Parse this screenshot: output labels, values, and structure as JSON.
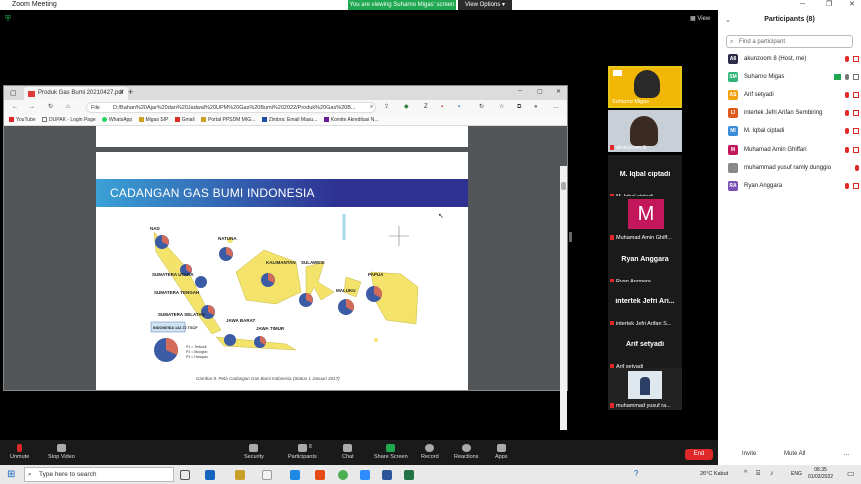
{
  "zoom": {
    "title": "Zoom Meeting",
    "share_banner": "You are viewing Suharno Migas' screen",
    "view_options": "View Options",
    "view_label": "View"
  },
  "browser": {
    "tab_title": "Produk Gas Bumi 20210427.pdf",
    "file_label": "File",
    "url": "D:/Bahan%20Ajar%20dan%20Jadwal%20UPM%20Gas%20Bumi%202022/Produk%20Gas%20B...",
    "bookmarks": [
      "YouTube",
      "DUPAK - Login Page",
      "WhatsApp",
      "Migas SIP",
      "Gmail",
      "Portal PPSDM MIG...",
      "Zimbra: Email Masu...",
      "Komite Akreditasi N..."
    ]
  },
  "slide": {
    "title": "CADANGAN GAS BUMI INDONESIA",
    "caption": "Gambar 8. Peta Cadangan Gas Bumi Indonesia (Status 1 Januari 2017)",
    "regions": [
      "NAD",
      "NATUNA",
      "SUMATERA UTARA",
      "KALIMANTAN",
      "SULAWESI",
      "PAPUA",
      "SUMATERA TENGAH",
      "MALUKU",
      "SUMATERA SELATAN",
      "JAWA BARAT",
      "JAWA TIMUR",
      "INDONESIA 142.72 TSCF"
    ],
    "legend": [
      "P1 = Terbukti",
      "P2 = Mungkin",
      "P3 = Harapan"
    ]
  },
  "tiles": [
    {
      "name": "Suharno Migas",
      "big": ""
    },
    {
      "name": "akunzoom 8",
      "big": ""
    },
    {
      "name": "M. Iqbal ciptadi",
      "big": "M. Iqbal ciptadi"
    },
    {
      "name": "Muhamad Amin Ghiff...",
      "big": "M"
    },
    {
      "name": "Ryan Anggara",
      "big": "Ryan Anggara"
    },
    {
      "name": "intertek Jefri Arifan S...",
      "big": "intertek Jefri Ari..."
    },
    {
      "name": "Arif setyadi",
      "big": "Arif setyadi"
    },
    {
      "name": "muhammad yusuf ra...",
      "big": ""
    }
  ],
  "panel": {
    "title": "Participants (8)",
    "search_placeholder": "Find a participant",
    "participants": [
      {
        "initials": "A8",
        "name": "akunzoom 8 (Host, me)",
        "color": "#2d2d4a"
      },
      {
        "initials": "SM",
        "name": "Suharno Migas",
        "color": "#2fb57a"
      },
      {
        "initials": "AS",
        "name": "Arif setyadi",
        "color": "#f2a20c"
      },
      {
        "initials": "IJ",
        "name": "intertek Jefri Arifan Sembiring",
        "color": "#e05a1b"
      },
      {
        "initials": "MI",
        "name": "M. Iqbal ciptadi",
        "color": "#3a8bd8"
      },
      {
        "initials": "M",
        "name": "Muhamad Amin Ghiffari",
        "color": "#c2185b"
      },
      {
        "initials": "",
        "name": "muhammad yusuf ramly dunggio",
        "color": "#888888"
      },
      {
        "initials": "RA",
        "name": "Ryan Anggara",
        "color": "#7b4fb5"
      }
    ],
    "invite": "Invite",
    "mute_all": "Mute All"
  },
  "toolbar": {
    "unmute": "Unmute",
    "stop_video": "Stop Video",
    "security": "Security",
    "participants": "Participants",
    "participants_count": "8",
    "chat": "Chat",
    "share_screen": "Share Screen",
    "record": "Record",
    "reactions": "Reactions",
    "apps": "Apps",
    "end": "End"
  },
  "taskbar": {
    "search_placeholder": "Type here to search",
    "weather": "26°C  Kabut",
    "lang": "ENG",
    "time": "08.35",
    "date": "01/03/2022"
  }
}
